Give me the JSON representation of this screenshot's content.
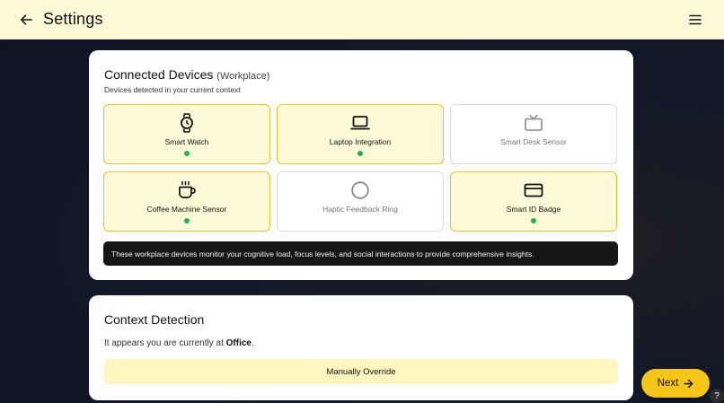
{
  "header": {
    "title": "Settings",
    "back_icon": "arrow-left-icon",
    "menu_icon": "hamburger-menu-icon"
  },
  "devices_card": {
    "title": "Connected Devices",
    "title_tag": "(Workplace)",
    "subtitle": "Devices detected in your current context",
    "devices": [
      {
        "label": "Smart Watch",
        "icon": "watch-icon",
        "connected": true
      },
      {
        "label": "Laptop Integration",
        "icon": "laptop-icon",
        "connected": true
      },
      {
        "label": "Smart Desk Sensor",
        "icon": "tv-icon",
        "connected": false
      },
      {
        "label": "Coffee Machine Sensor",
        "icon": "coffee-cup-icon",
        "connected": true
      },
      {
        "label": "Haptic Feedback Ring",
        "icon": "ring-icon",
        "connected": false
      },
      {
        "label": "Smart ID Badge",
        "icon": "badge-card-icon",
        "connected": true
      }
    ],
    "info": "These workplace devices monitor your cognitive load, focus levels, and social interactions to provide comprehensive insights."
  },
  "context_card": {
    "title": "Context Detection",
    "text_prefix": "It appears you are currently at ",
    "location": "Office",
    "text_suffix": ".",
    "override_label": "Manually Override"
  },
  "footer": {
    "next_label": "Next",
    "help_label": "?"
  },
  "colors": {
    "header_bg": "#fffbd8",
    "active_border": "#e3c43a",
    "status_green": "#22b34f",
    "accent": "#f5c518"
  }
}
